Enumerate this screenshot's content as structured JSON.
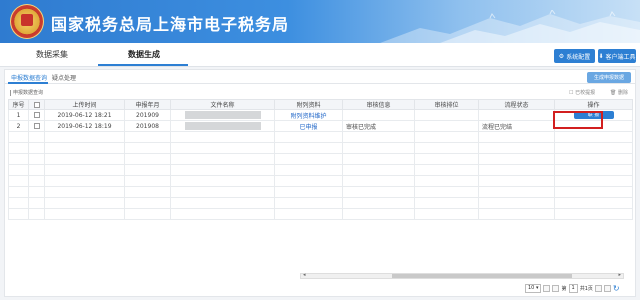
{
  "header": {
    "title": "国家税务总局上海市电子税务局",
    "colors": {
      "banner": "#2f7bd0",
      "accent": "#2d7fd3",
      "highlight": "#d21f1f"
    }
  },
  "main_tabs": [
    {
      "label": "数据采集"
    },
    {
      "label": "数据生成"
    }
  ],
  "header_buttons": [
    {
      "label": "系统配置",
      "icon": "gear-icon"
    },
    {
      "label": "客户端工具",
      "icon": "download-icon"
    }
  ],
  "sub_tabs": [
    {
      "label": "申报数据查询"
    },
    {
      "label": "疑点处理"
    }
  ],
  "generate_button": "生成申报数据",
  "query_label": "申报数据查询",
  "mini_actions": [
    {
      "label": "已校提报"
    },
    {
      "label": "删除"
    }
  ],
  "table": {
    "headers": [
      "序号",
      "",
      "上传时间",
      "申报年月",
      "文件名称",
      "附列资料",
      "审核信息",
      "审核排位",
      "流程状态",
      "操作"
    ],
    "rows": [
      {
        "index": "1",
        "time": "2019-06-12 18:21",
        "period": "201909",
        "attachment": "附列资料维护",
        "audit": "",
        "rank": "",
        "status": "",
        "action": "联 报"
      },
      {
        "index": "2",
        "time": "2019-06-12 18:19",
        "period": "201908",
        "attachment": "已申报",
        "audit": "审核已完成",
        "rank": "",
        "status": "流程已完结",
        "action": ""
      }
    ]
  },
  "pager": {
    "page_size": "10",
    "page": "1",
    "total": "共1页"
  }
}
